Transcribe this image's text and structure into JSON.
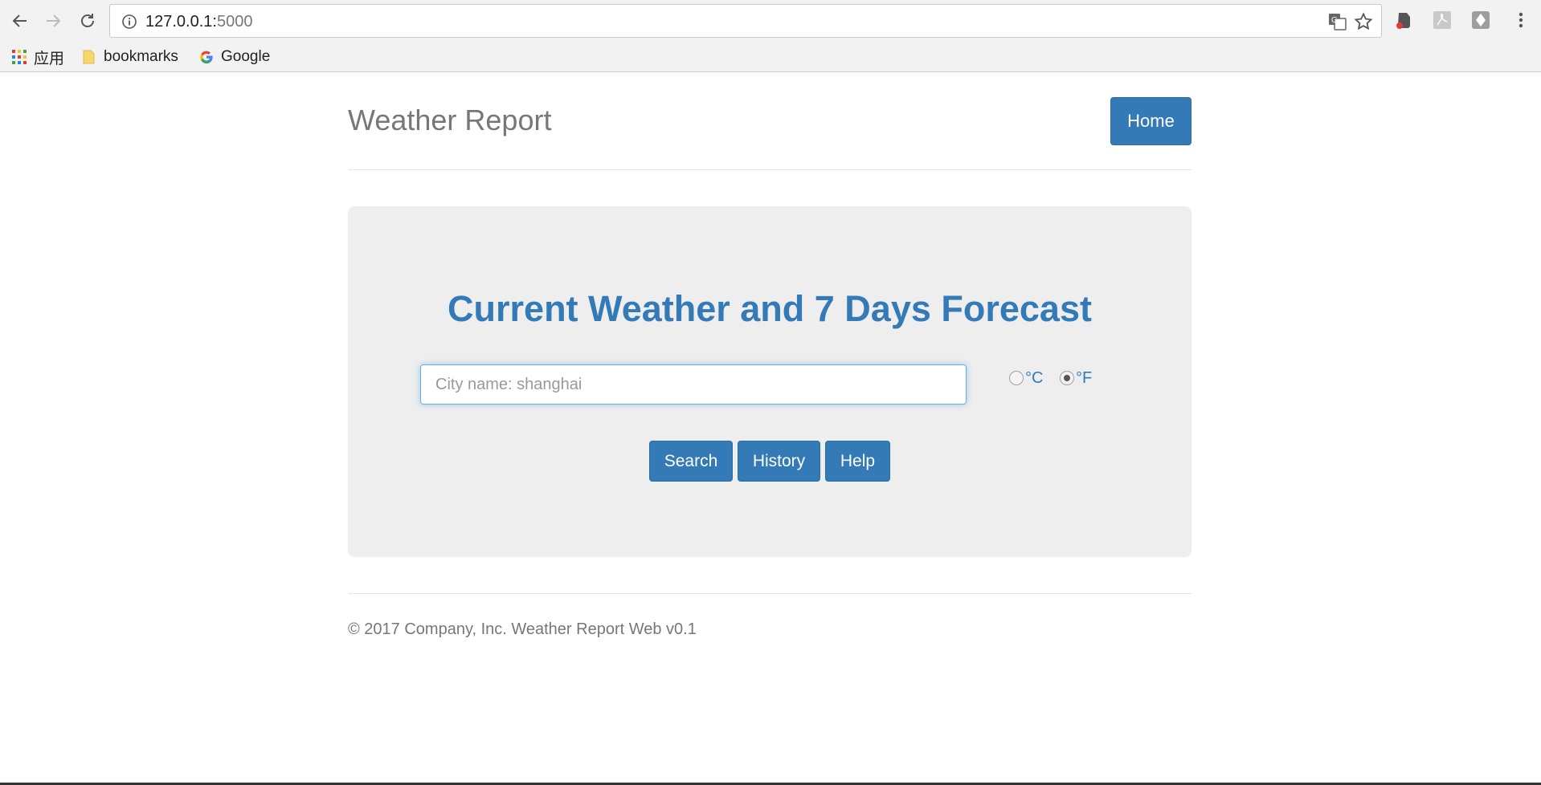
{
  "browser": {
    "url_host": "127.0.0.1:",
    "url_port": "5000",
    "bookmarks": [
      {
        "label": "应用",
        "icon": "apps-grid-icon"
      },
      {
        "label": "bookmarks",
        "icon": "folder-icon"
      },
      {
        "label": "Google",
        "icon": "google-g-icon"
      }
    ]
  },
  "header": {
    "title": "Weather Report",
    "home_label": "Home"
  },
  "main": {
    "headline": "Current Weather and 7 Days Forecast",
    "city_placeholder": "City name: shanghai",
    "units": [
      {
        "label": "°C",
        "checked": false
      },
      {
        "label": "°F",
        "checked": true
      }
    ],
    "buttons": {
      "search": "Search",
      "history": "History",
      "help": "Help"
    }
  },
  "footer": {
    "text": "© 2017 Company, Inc. Weather Report Web v0.1"
  },
  "colors": {
    "primary": "#337ab7",
    "jumbotron_bg": "#eeeeee",
    "muted_text": "#777777"
  }
}
